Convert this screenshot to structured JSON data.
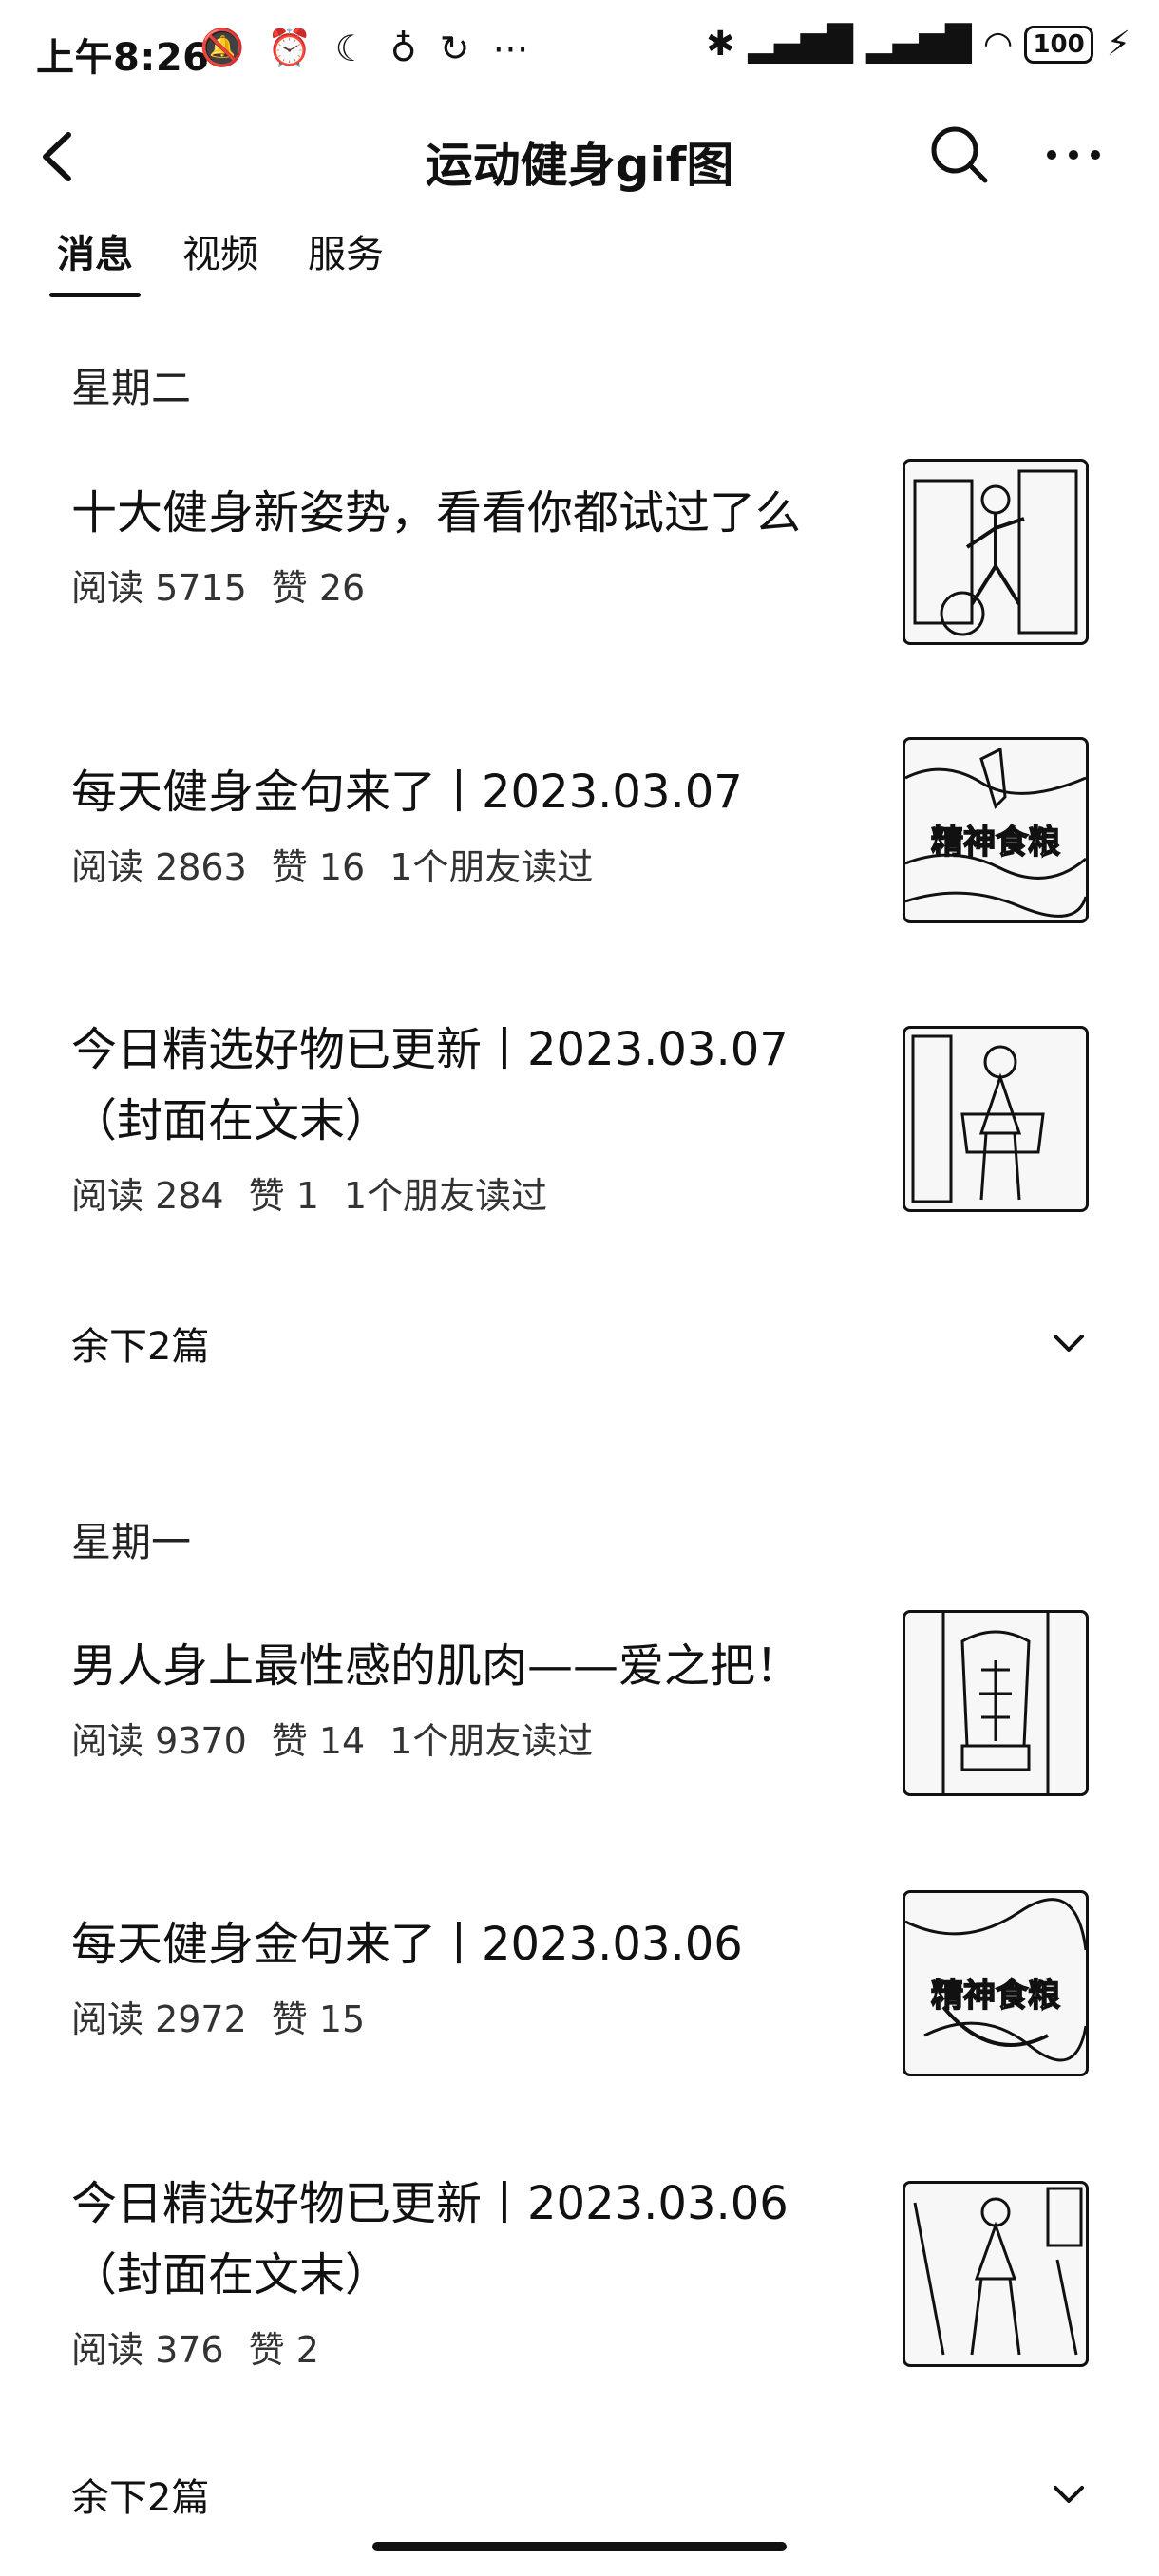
{
  "status_bar": {
    "time": "上午8:26",
    "battery": "100"
  },
  "header": {
    "title": "运动健身gif图"
  },
  "tabs": [
    {
      "label": "消息"
    },
    {
      "label": "视频"
    },
    {
      "label": "服务"
    }
  ],
  "sections": [
    {
      "day": "星期二",
      "articles": [
        {
          "title": "十大健身新姿势，看看你都试过了么",
          "reads": "阅读 5715",
          "likes": "赞 26",
          "friends": ""
        },
        {
          "title": "每天健身金句来了丨2023.03.07",
          "reads": "阅读 2863",
          "likes": "赞 16",
          "friends": "1个朋友读过",
          "thumb_caption": "精神食粮"
        },
        {
          "title": "今日精选好物已更新丨2023.03.07（封面在文末）",
          "reads": "阅读 284",
          "likes": "赞 1",
          "friends": "1个朋友读过"
        }
      ],
      "more_label": "余下2篇"
    },
    {
      "day": "星期一",
      "articles": [
        {
          "title": "男人身上最性感的肌肉——爱之把！",
          "reads": "阅读 9370",
          "likes": "赞 14",
          "friends": "1个朋友读过"
        },
        {
          "title": "每天健身金句来了丨2023.03.06",
          "reads": "阅读 2972",
          "likes": "赞 15",
          "friends": "",
          "thumb_caption": "精神食粮"
        },
        {
          "title": "今日精选好物已更新丨2023.03.06（封面在文末）",
          "reads": "阅读 376",
          "likes": "赞 2",
          "friends": ""
        }
      ],
      "more_label": "余下2篇"
    }
  ]
}
